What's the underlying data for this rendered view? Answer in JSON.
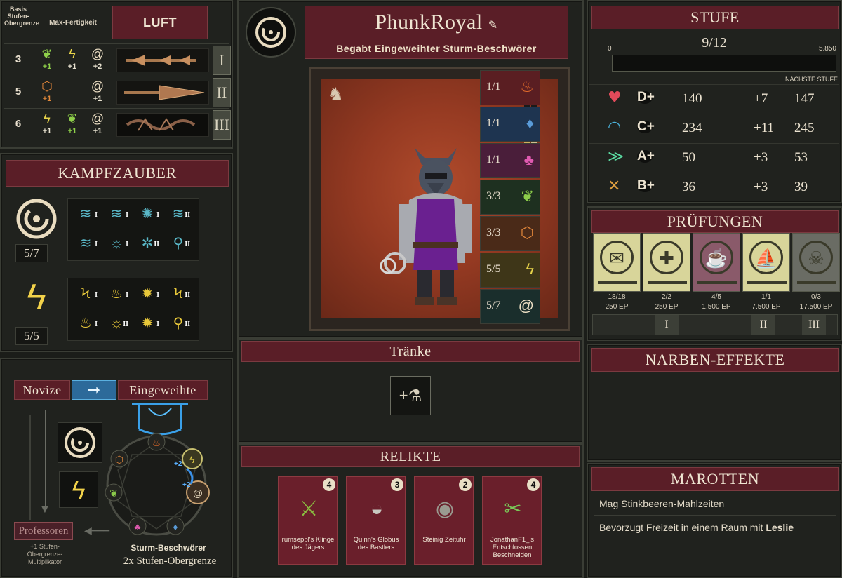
{
  "levels_table": {
    "header_basis": "Basis Stufen-Obergrenze",
    "header_max": "Max-Fertigkeit",
    "element_title": "LUFT",
    "rows": [
      {
        "basis": "3",
        "bonuses": [
          {
            "icon": "leaf-icon",
            "value": "+1"
          },
          {
            "icon": "lightning-icon",
            "value": "+1"
          },
          {
            "icon": "swirl-icon",
            "value": "+2"
          }
        ],
        "numeral": "I"
      },
      {
        "basis": "5",
        "bonuses": [
          {
            "icon": "crystal-icon",
            "value": "+1"
          },
          {
            "icon": "",
            "value": ""
          },
          {
            "icon": "swirl-icon",
            "value": "+1"
          }
        ],
        "numeral": "II"
      },
      {
        "basis": "6",
        "bonuses": [
          {
            "icon": "lightning-icon",
            "value": "+1"
          },
          {
            "icon": "leaf-icon",
            "value": "+1"
          },
          {
            "icon": "swirl-icon",
            "value": "+1"
          }
        ],
        "numeral": "III"
      }
    ]
  },
  "spells": {
    "title": "KAMPFZAUBER",
    "groups": [
      {
        "icon": "air-swirl-icon",
        "count": "5/7",
        "numerals": [
          "I",
          "I",
          "I",
          "II",
          "I",
          "I",
          "II",
          "II"
        ]
      },
      {
        "icon": "lightning-icon",
        "count": "5/5",
        "numerals": [
          "I",
          "I",
          "I",
          "II",
          "I",
          "II",
          "I",
          "II"
        ]
      }
    ]
  },
  "progression": {
    "from": "Novize",
    "to": "Eingeweihte",
    "professors": "Professoren",
    "professors_note": "+1 Stufen-Obergrenze-Multiplikator",
    "class_name": "Sturm-Beschwörer",
    "class_bonus": "2x Stufen-Obergrenze",
    "wheel_bonuses": [
      "+2",
      "+2"
    ]
  },
  "character": {
    "name": "PhunkRoyal",
    "title": "Begabt Eingeweihter Sturm-Beschwörer",
    "potencies": [
      {
        "count": "1/1",
        "icon": "fire-icon",
        "color": "#e06a2a"
      },
      {
        "count": "1/1",
        "icon": "water-icon",
        "color": "#5a9bd8"
      },
      {
        "count": "1/1",
        "icon": "tentacle-icon",
        "color": "#e05ab0"
      },
      {
        "count": "3/3",
        "icon": "leaf-icon",
        "color": "#8ccc4a"
      },
      {
        "count": "3/3",
        "icon": "crystal-icon",
        "color": "#e0853a"
      },
      {
        "count": "5/5",
        "icon": "lightning-icon",
        "color": "#e8d44a"
      },
      {
        "count": "5/7",
        "icon": "air-swirl-icon",
        "color": "#efe1c6"
      }
    ]
  },
  "potions": {
    "title": "Tränke"
  },
  "relics": {
    "title": "RELIKTE",
    "items": [
      {
        "name": "rumseppl's Klinge des Jägers",
        "level": "4",
        "icon": "blade-icon"
      },
      {
        "name": "Quinn's Globus des Bastlers",
        "level": "3",
        "icon": "globe-icon"
      },
      {
        "name": "Steinig Zeituhr",
        "level": "2",
        "icon": "clock-icon"
      },
      {
        "name": "JonathanF1_'s Entschlossen Beschneiden",
        "level": "4",
        "icon": "shears-icon"
      }
    ]
  },
  "stufe": {
    "title": "STUFE",
    "level": "9/12",
    "xp_min": "0",
    "xp_max": "5.850",
    "xp_progress": 0.0,
    "next_label": "NÄCHSTE STUFE",
    "stats": [
      {
        "icon": "heart-max-icon",
        "grade": "D+",
        "base": "140",
        "bonus": "+7",
        "total": "147",
        "color": "#e04a5a"
      },
      {
        "icon": "mana-max-icon",
        "grade": "C+",
        "base": "234",
        "bonus": "+11",
        "total": "245",
        "color": "#4ab0d8"
      },
      {
        "icon": "speed-icon",
        "grade": "A+",
        "base": "50",
        "bonus": "+3",
        "total": "53",
        "color": "#5ad8a0"
      },
      {
        "icon": "attack-icon",
        "grade": "B+",
        "base": "36",
        "bonus": "+3",
        "total": "39",
        "color": "#e0a040"
      }
    ]
  },
  "trials": {
    "title": "PRÜFUNGEN",
    "items": [
      {
        "progress": "18/18",
        "xp": "250 EP",
        "color": "#d8d59a"
      },
      {
        "progress": "2/2",
        "xp": "250 EP",
        "color": "#d8d59a"
      },
      {
        "progress": "4/5",
        "xp": "1.500 EP",
        "color": "#8a5a6a"
      },
      {
        "progress": "1/1",
        "xp": "7.500 EP",
        "color": "#d8d59a"
      },
      {
        "progress": "0/3",
        "xp": "17.500 EP",
        "color": "#6a6c64"
      }
    ],
    "tiers": [
      "I",
      "II",
      "III"
    ]
  },
  "scars": {
    "title": "NARBEN-EFFEKTE"
  },
  "quirks": {
    "title": "MAROTTEN",
    "items": [
      {
        "text": "Mag Stinkbeeren-Mahlzeiten",
        "bold": ""
      },
      {
        "text": "Bevorzugt Freizeit in einem Raum mit ",
        "bold": "Leslie"
      }
    ]
  }
}
